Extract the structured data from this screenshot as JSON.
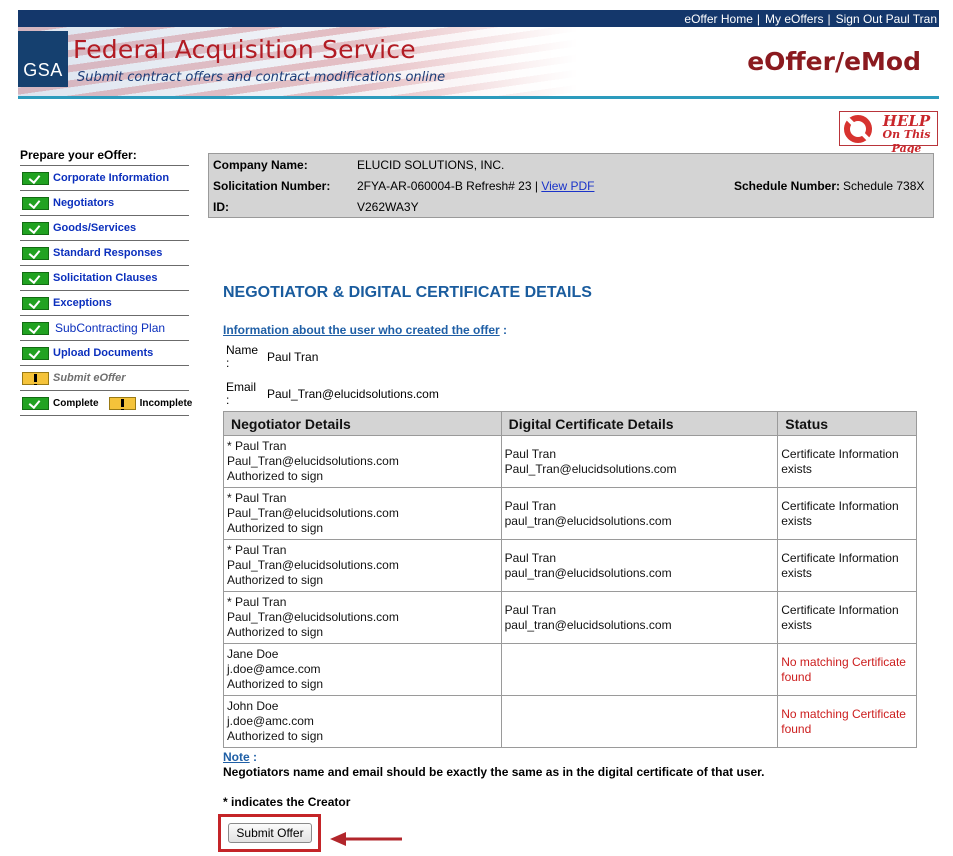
{
  "topnav": {
    "home": "eOffer Home",
    "sep1": "|",
    "my_eoffers": "My eOffers",
    "sep2": "|",
    "sign_out": "Sign Out Paul Tran"
  },
  "banner": {
    "logo": "GSA",
    "title": "Federal Acquisition Service",
    "subtitle": "Submit contract offers and contract modifications online",
    "app_name": "eOffer/eMod"
  },
  "help": {
    "line1": "HELP",
    "line2": "On This Page"
  },
  "sidebar": {
    "heading": "Prepare your eOffer:",
    "items": [
      {
        "label": "Corporate Information",
        "status": "complete"
      },
      {
        "label": "Negotiators",
        "status": "complete"
      },
      {
        "label": "Goods/Services",
        "status": "complete"
      },
      {
        "label": "Standard Responses",
        "status": "complete"
      },
      {
        "label": "Solicitation Clauses",
        "status": "complete"
      },
      {
        "label": "Exceptions",
        "status": "complete"
      },
      {
        "label": "SubContracting Plan",
        "status": "complete"
      },
      {
        "label": "Upload Documents",
        "status": "complete"
      },
      {
        "label": "Submit eOffer",
        "status": "incomplete"
      }
    ],
    "legend": {
      "complete": "Complete",
      "incomplete": "Incomplete"
    }
  },
  "info": {
    "company_label": "Company Name:",
    "company_value": "ELUCID SOLUTIONS, INC.",
    "solicitation_label": "Solicitation Number:",
    "solicitation_value": "2FYA-AR-060004-B Refresh# 23 |",
    "view_pdf": "View PDF",
    "schedule_label": "Schedule Number:",
    "schedule_value": "Schedule 738X",
    "id_label": "ID:",
    "id_value": "V262WA3Y"
  },
  "section": {
    "title": "NEGOTIATOR & DIGITAL CERTIFICATE DETAILS",
    "creator_link": "Information about the user who created the offer",
    "creator_colon": " :",
    "name_label": "Name :",
    "name_value": "Paul Tran",
    "email_label": "Email :",
    "email_value": "Paul_Tran@elucidsolutions.com"
  },
  "table": {
    "headers": [
      "Negotiator Details",
      "Digital Certificate Details",
      "Status"
    ],
    "rows": [
      {
        "neg": [
          "*  Paul Tran",
          "Paul_Tran@elucidsolutions.com",
          "Authorized to sign"
        ],
        "cert": [
          "Paul Tran",
          "Paul_Tran@elucidsolutions.com"
        ],
        "status": [
          "Certificate Information",
          "exists"
        ]
      },
      {
        "neg": [
          "*  Paul Tran",
          "Paul_Tran@elucidsolutions.com",
          "Authorized to sign"
        ],
        "cert": [
          "Paul Tran",
          "paul_tran@elucidsolutions.com"
        ],
        "status": [
          "Certificate Information",
          "exists"
        ]
      },
      {
        "neg": [
          "*  Paul Tran",
          "Paul_Tran@elucidsolutions.com",
          "Authorized to sign"
        ],
        "cert": [
          "Paul Tran",
          "paul_tran@elucidsolutions.com"
        ],
        "status": [
          "Certificate Information",
          "exists"
        ]
      },
      {
        "neg": [
          "*  Paul Tran",
          "Paul_Tran@elucidsolutions.com",
          "Authorized to sign"
        ],
        "cert": [
          "Paul Tran",
          "paul_tran@elucidsolutions.com"
        ],
        "status": [
          "Certificate Information",
          "exists"
        ]
      },
      {
        "neg": [
          "Jane Doe",
          "j.doe@amce.com",
          "Authorized to sign"
        ],
        "cert": [
          "",
          ""
        ],
        "status": [
          "No matching Certificate",
          "found"
        ]
      },
      {
        "neg": [
          "John Doe",
          "j.doe@amc.com",
          "Authorized to sign"
        ],
        "cert": [
          "",
          ""
        ],
        "status": [
          "No matching Certificate",
          "found"
        ]
      }
    ]
  },
  "note": {
    "label": "Note",
    "colon": " :",
    "text": "Negotiators name and email should be exactly the same as in the digital certificate of that user.",
    "creator": "* indicates the Creator"
  },
  "submit": {
    "label": "Submit Offer"
  },
  "colors": {
    "nav": "#14376b",
    "brand_red": "#b21c24",
    "accent_line": "#2c9bbd",
    "complete_green": "#21a221",
    "incomplete_yellow": "#f5c33a",
    "no_match_red": "#cc1d1d"
  }
}
